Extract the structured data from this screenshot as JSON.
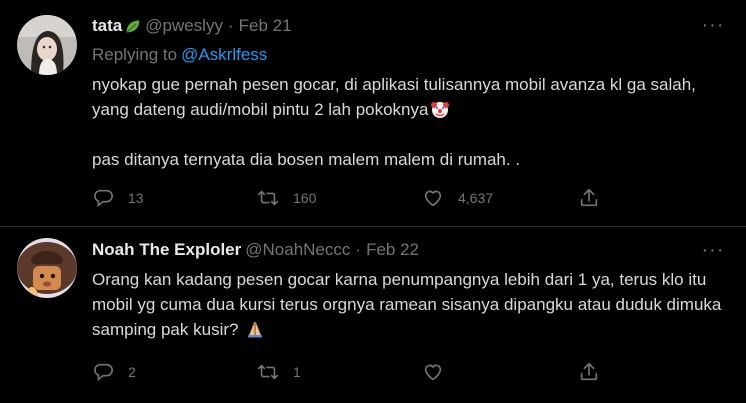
{
  "tweets": [
    {
      "name": "tata",
      "handle": "@pweslyy",
      "date": "Feb 21",
      "reply_prefix": "Replying to",
      "reply_to": "@Askrlfess",
      "text_line1": "nyokap gue pernah pesen gocar, di aplikasi tulisannya mobil avanza kl ga salah, yang dateng audi/mobil pintu 2 lah pokoknya",
      "text_line2": "pas ditanya ternyata dia bosen malem malem di rumah. .",
      "replies": "13",
      "retweets": "160",
      "likes": "4,637"
    },
    {
      "name": "Noah The Exploler",
      "handle": "@NoahNeccc",
      "date": "Feb 22",
      "text_line1": "Orang kan kadang pesen gocar karna penumpangnya lebih dari 1 ya, terus klo itu mobil yg cuma dua kursi terus orgnya ramean sisanya dipangku atau duduk dimuka samping pak kusir?",
      "replies": "2",
      "retweets": "1",
      "likes": ""
    }
  ],
  "ui": {
    "dot": "·",
    "more": "···"
  },
  "colors": {
    "background": "#000000",
    "text": "#d9d9d9",
    "muted": "#71767b",
    "accent": "#1d9bf0",
    "divider": "#2f3336"
  },
  "icons": {
    "tweet1_name_emoji": "leaf-icon",
    "tweet1_end_emoji": "clown-face-icon",
    "tweet2_end_emoji": "folded-hands-icon",
    "actions": [
      "reply-icon",
      "retweet-icon",
      "like-icon",
      "share-icon"
    ]
  }
}
